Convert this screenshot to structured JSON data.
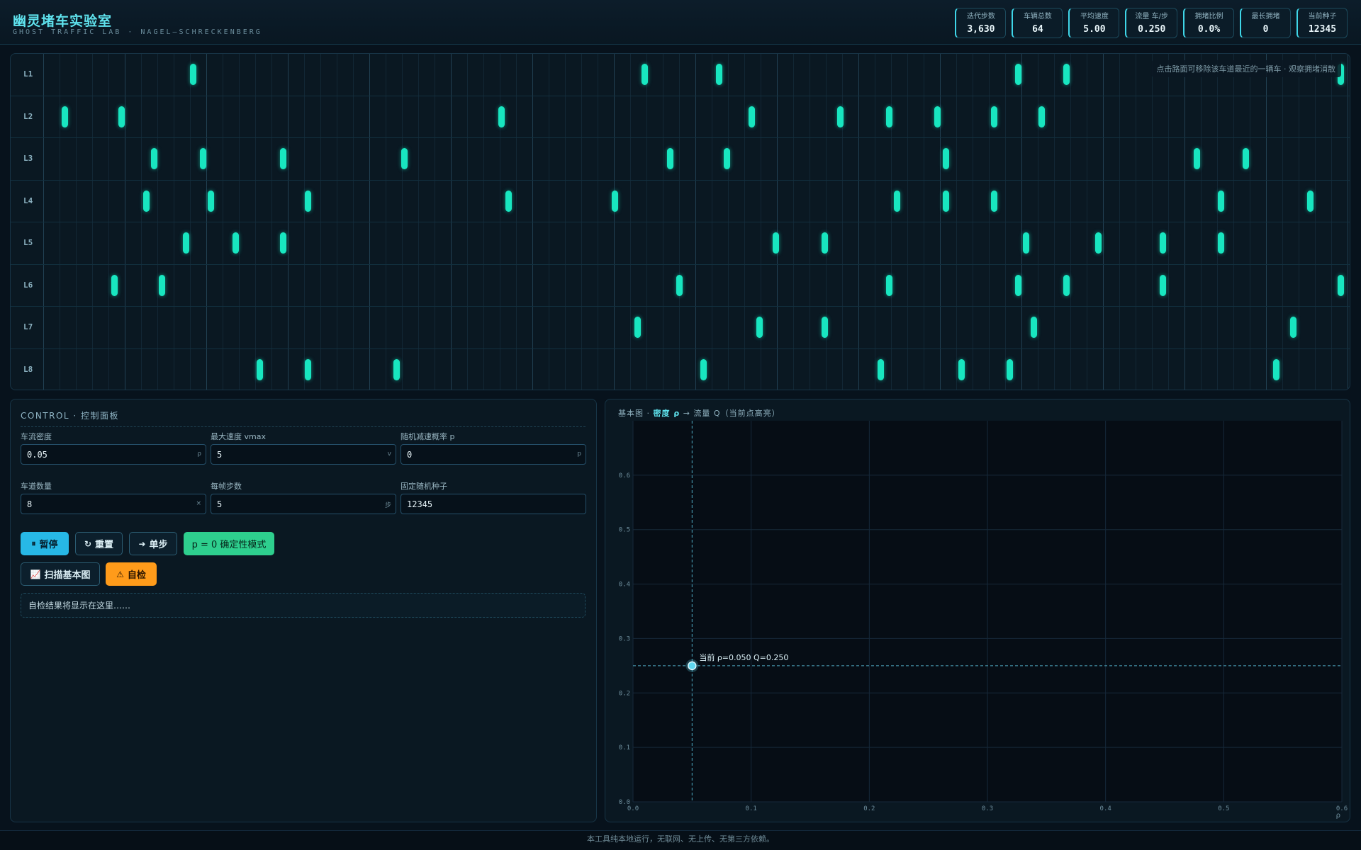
{
  "header": {
    "title": "幽灵堵车实验室",
    "subtitle": "GHOST TRAFFIC LAB · NAGEL–SCHRECKENBERG"
  },
  "stats": [
    {
      "label": "迭代步数",
      "value": "3,630"
    },
    {
      "label": "车辆总数",
      "value": "64"
    },
    {
      "label": "平均速度",
      "value": "5.00"
    },
    {
      "label": "流量 车/步",
      "value": "0.250"
    },
    {
      "label": "拥堵比例",
      "value": "0.0%"
    },
    {
      "label": "最长拥堵",
      "value": "0"
    },
    {
      "label": "当前种子",
      "value": "12345"
    }
  ],
  "road": {
    "hint": "点击路面可移除该车道最近的一辆车 · 观察拥堵消散",
    "lanes": [
      {
        "label": "L1",
        "cars": [
          0.108,
          0.458,
          0.516,
          0.748,
          0.785,
          0.998
        ]
      },
      {
        "label": "L2",
        "cars": [
          0.009,
          0.053,
          0.347,
          0.541,
          0.61,
          0.648,
          0.685,
          0.729,
          0.766
        ]
      },
      {
        "label": "L3",
        "cars": [
          0.078,
          0.116,
          0.178,
          0.272,
          0.478,
          0.522,
          0.692,
          0.886,
          0.924
        ]
      },
      {
        "label": "L4",
        "cars": [
          0.072,
          0.122,
          0.197,
          0.353,
          0.435,
          0.654,
          0.692,
          0.729,
          0.905,
          0.974
        ]
      },
      {
        "label": "L5",
        "cars": [
          0.103,
          0.141,
          0.178,
          0.56,
          0.598,
          0.754,
          0.81,
          0.86,
          0.905
        ]
      },
      {
        "label": "L6",
        "cars": [
          0.047,
          0.084,
          0.485,
          0.648,
          0.748,
          0.785,
          0.86,
          0.998
        ]
      },
      {
        "label": "L7",
        "cars": [
          0.453,
          0.547,
          0.598,
          0.76,
          0.961
        ]
      },
      {
        "label": "L8",
        "cars": [
          0.16,
          0.197,
          0.266,
          0.504,
          0.641,
          0.704,
          0.741,
          0.948
        ]
      }
    ]
  },
  "control": {
    "title": "CONTROL · 控制面板",
    "fields": [
      {
        "label": "车流密度",
        "value": "0.05",
        "unit": "ρ"
      },
      {
        "label": "最大速度 vmax",
        "value": "5",
        "unit": "v"
      },
      {
        "label": "随机减速概率 p",
        "value": "0",
        "unit": "p"
      },
      {
        "label": "车道数量",
        "value": "8",
        "unit": "×"
      },
      {
        "label": "每帧步数",
        "value": "5",
        "unit": "步"
      },
      {
        "label": "固定随机种子",
        "value": "12345",
        "unit": ""
      }
    ],
    "buttons": {
      "pause": "暂停",
      "reset": "重置",
      "step": "单步",
      "deterministic": "p = 0 确定性模式",
      "scan": "扫描基本图",
      "check": "自检"
    },
    "check_result": "自检结果将显示在这里……"
  },
  "chart": {
    "title_prefix": "基本图 · ",
    "title_bold": "密度 ρ",
    "title_suffix": " → 流量 Q（当前点高亮）"
  },
  "chart_data": {
    "type": "scatter",
    "title": "基本图 · 密度 ρ → 流量 Q（当前点高亮）",
    "xlabel": "ρ",
    "ylabel": "",
    "xlim": [
      0,
      0.6
    ],
    "ylim": [
      0,
      0.7
    ],
    "xticks": [
      "0.0",
      "0.1",
      "0.2",
      "0.3",
      "0.4",
      "0.5",
      "0.6"
    ],
    "yticks": [
      "0.0",
      "0.1",
      "0.2",
      "0.3",
      "0.4",
      "0.5",
      "0.6"
    ],
    "current_point": {
      "x": 0.05,
      "y": 0.25
    },
    "annotation": "当前 ρ=0.050  Q=0.250",
    "grid": true,
    "colors": {
      "point": "#5fd8f0",
      "crosshair": "#4fa8c0"
    }
  },
  "footer": "本工具纯本地运行，无联网、无上传、无第三方依赖。"
}
